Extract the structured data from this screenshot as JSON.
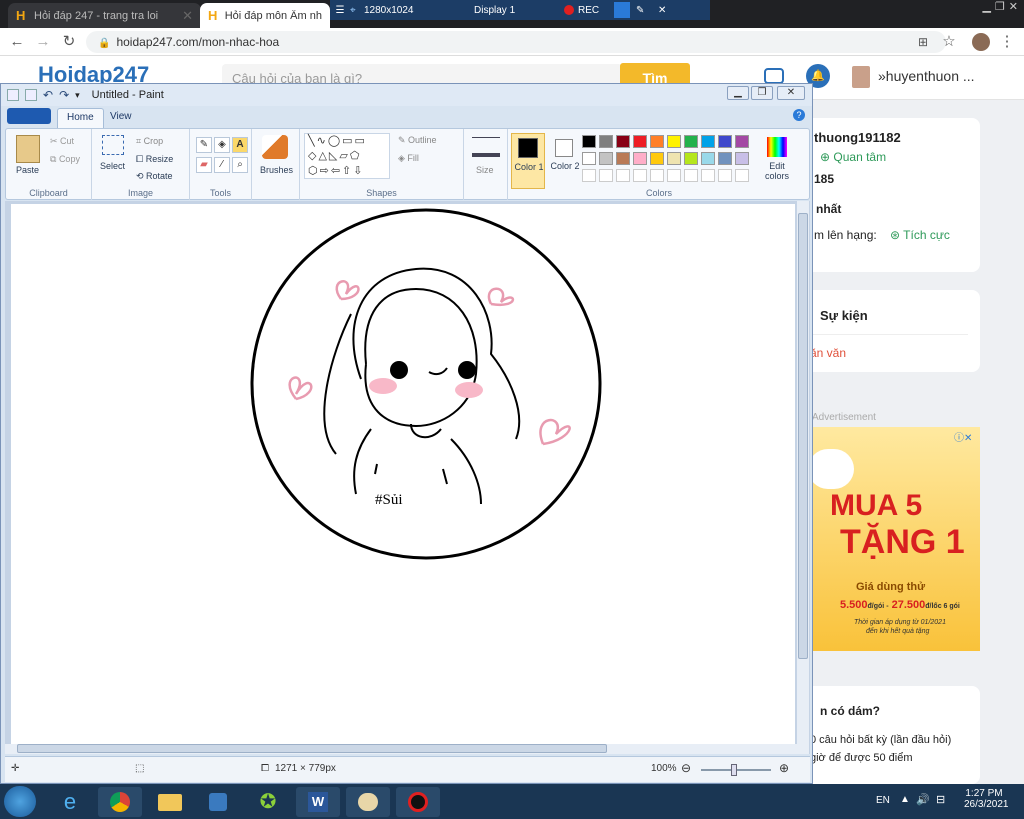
{
  "browser": {
    "tabs": [
      {
        "title": "Hỏi đáp 247 - trang tra loi",
        "active": false
      },
      {
        "title": "Hỏi đáp môn Âm nhạc",
        "active": true
      }
    ],
    "url": "hoidap247.com/mon-nhac-hoa"
  },
  "recorder": {
    "resolution": "1280x1024",
    "display": "Display 1",
    "rec": "REC"
  },
  "site": {
    "logo": "Hoidap247",
    "search_placeholder": "Câu hỏi của bạn là gì?",
    "search_button": "Tìm",
    "username": "huyenthuon ...",
    "profile_name": "thuong191182",
    "follow": "Quan tâm",
    "points": "185",
    "rank_label": "nhất",
    "rank_up": "m lên hạng:",
    "rank_status": "Tích cực",
    "events_title": "Sự kiện",
    "events_link": "ăn văn",
    "ad_label": "Advertisement",
    "ad_title1": "MUA 5",
    "ad_title2": "TẶNG 1",
    "ad_trial": "Giá dùng thử",
    "ad_price1": "5.500",
    "ad_price1_unit": "đ/gói -",
    "ad_price2": "27.500",
    "ad_price2_unit": "đ/lốc 6 gói",
    "ad_note1": "Thời gian áp dụng từ 01/2021",
    "ad_note2": "đến khi hết quà tặng",
    "question_title": "n có dám?",
    "question_line1": "0 câu hỏi  bất kỳ (lần đầu hỏi)",
    "question_line2": "giờ để được 50 điểm"
  },
  "paint": {
    "title": "Untitled - Paint",
    "tabs": [
      "Home",
      "View"
    ],
    "clipboard": {
      "paste": "Paste",
      "cut": "Cut",
      "copy": "Copy",
      "group": "Clipboard"
    },
    "image": {
      "select": "Select",
      "crop": "Crop",
      "resize": "Resize",
      "rotate": "Rotate",
      "group": "Image"
    },
    "tools_group": "Tools",
    "brushes": "Brushes",
    "shapes": {
      "outline": "Outline",
      "fill": "Fill",
      "group": "Shapes"
    },
    "size": "Size",
    "color1": "Color 1",
    "color2": "Color 2",
    "edit_colors": "Edit colors",
    "colors_group": "Colors",
    "palette": [
      "#000000",
      "#7f7f7f",
      "#880015",
      "#ed1c24",
      "#ff7f27",
      "#fff200",
      "#22b14c",
      "#00a2e8",
      "#3f48cc",
      "#a349a4",
      "#ffffff",
      "#c3c3c3",
      "#b97a57",
      "#ffaec9",
      "#ffc90e",
      "#efe4b0",
      "#b5e61d",
      "#99d9ea",
      "#7092be",
      "#c8bfe7"
    ],
    "drawing_text": "#Sủi",
    "status_size": "1271 × 779px",
    "zoom": "100%"
  },
  "taskbar": {
    "lang": "EN",
    "time": "1:27 PM",
    "date": "26/3/2021"
  }
}
